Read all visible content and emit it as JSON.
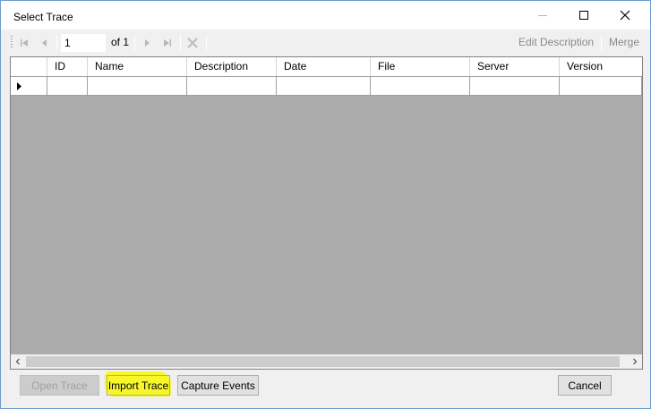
{
  "window": {
    "title": "Select Trace"
  },
  "toolbar": {
    "page_value": "1",
    "of_label": "of 1",
    "edit_description": "Edit Description",
    "merge": "Merge"
  },
  "grid": {
    "columns": [
      "ID",
      "Name",
      "Description",
      "Date",
      "File",
      "Server",
      "Version"
    ]
  },
  "buttons": {
    "open_trace": "Open Trace",
    "import_trace": "Import Trace",
    "capture_events": "Capture Events",
    "cancel": "Cancel"
  },
  "colors": {
    "highlight": "#f6f61f",
    "grid_background": "#ababab"
  }
}
